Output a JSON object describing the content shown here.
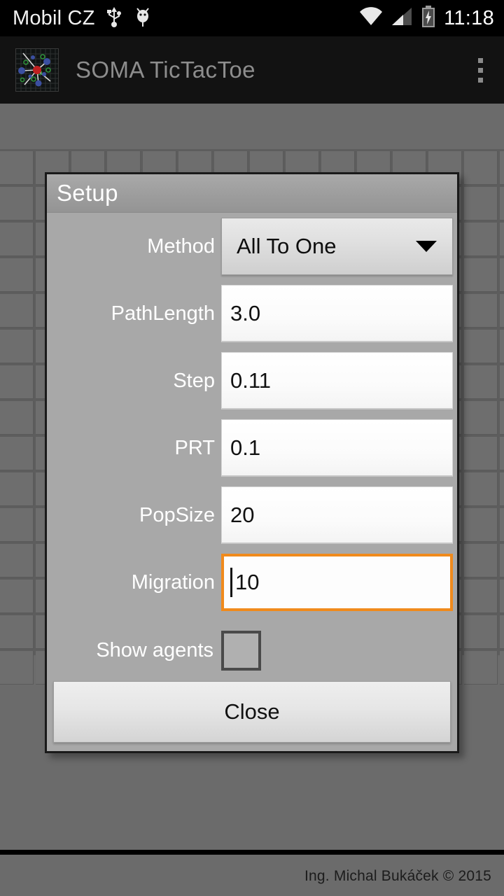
{
  "status_bar": {
    "carrier": "Mobil CZ",
    "clock": "11:18",
    "icons": [
      "usb-icon",
      "android-debug-icon",
      "wifi-icon",
      "cell-signal-icon",
      "battery-charging-icon"
    ]
  },
  "action_bar": {
    "app_title": "SOMA TicTacToe",
    "logo_icon": "soma-swarm-logo-icon",
    "overflow_icon": "overflow-menu-icon"
  },
  "board": {
    "columns": 15,
    "rows": 15
  },
  "dialog": {
    "title": "Setup",
    "fields": [
      {
        "label": "Method",
        "value": "All To One",
        "type": "spinner"
      },
      {
        "label": "PathLength",
        "value": "3.0",
        "type": "text"
      },
      {
        "label": "Step",
        "value": "0.11",
        "type": "text"
      },
      {
        "label": "PRT",
        "value": "0.1",
        "type": "text"
      },
      {
        "label": "PopSize",
        "value": "20",
        "type": "text"
      },
      {
        "label": "Migration",
        "value": "10",
        "type": "text",
        "focused": true
      }
    ],
    "checkbox": {
      "label": "Show agents",
      "checked": false
    },
    "close_label": "Close",
    "focus_color": "#f08a1c"
  },
  "footer": {
    "credit": "Ing. Michal Bukáček © 2015"
  }
}
